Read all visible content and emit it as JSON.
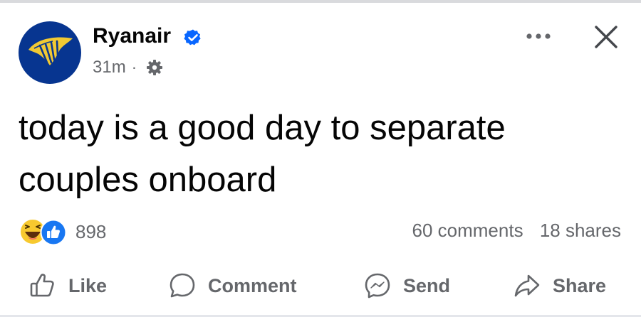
{
  "post": {
    "author": "Ryanair",
    "author_verified": true,
    "time": "31m",
    "separator": "·",
    "audience_icon": "gear-icon",
    "text": "today is a good day to separate couples onboard"
  },
  "engagement": {
    "reaction_icons": [
      "haha-icon",
      "like-icon"
    ],
    "reaction_count": "898",
    "comments": "60 comments",
    "shares": "18 shares"
  },
  "actions": {
    "like": "Like",
    "comment": "Comment",
    "send": "Send",
    "share": "Share"
  },
  "colors": {
    "text_primary": "#050505",
    "text_secondary": "#65676b",
    "verified_blue": "#0866ff",
    "brand_navy": "#073590",
    "brand_yellow": "#f1c933"
  }
}
